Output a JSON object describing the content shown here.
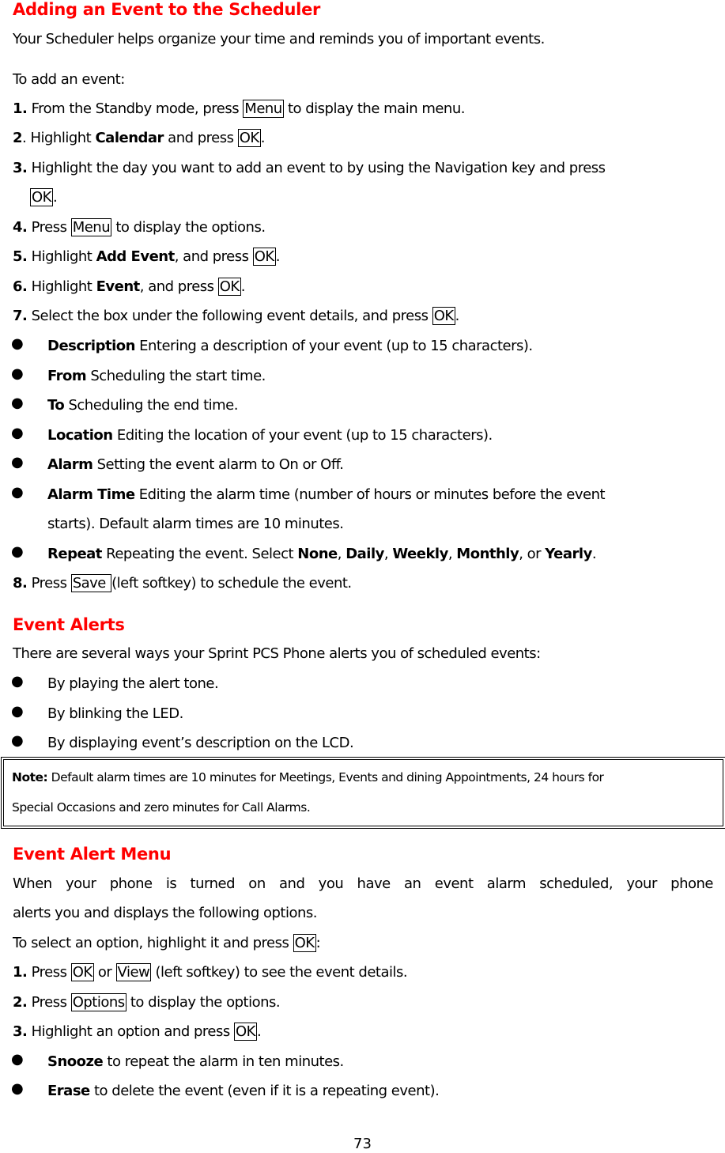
{
  "section1": {
    "title": "Adding an Event to the Scheduler",
    "intro": "Your Scheduler helps organize your time and reminds you of important events.",
    "lead": "To add an event:",
    "steps": [
      {
        "num": "1.",
        "pre": " From the Standby mode, press ",
        "key": "Menu",
        "post": " to display the main menu."
      },
      {
        "num": "2",
        "pre": ". Highlight ",
        "bold": "Calendar",
        "mid": " and press ",
        "key": "OK",
        "post": "."
      },
      {
        "num": "3.",
        "pre": " Highlight the day you want to add an event to by using the Navigation key and press",
        "key": "OK",
        "post": "."
      },
      {
        "num": "4.",
        "pre": " Press ",
        "key": "Menu",
        "post": " to display the options."
      },
      {
        "num": "5.",
        "pre": " Highlight ",
        "bold": "Add Event",
        "mid": ", and press ",
        "key": "OK",
        "post": "."
      },
      {
        "num": "6.",
        "pre": " Highlight ",
        "bold": "Event",
        "mid": ", and press ",
        "key": "OK",
        "post": "."
      },
      {
        "num": "7.",
        "pre": " Select the box under the following event details, and press ",
        "key": "OK",
        "post": "."
      }
    ],
    "details": [
      {
        "term": "Description",
        "text": " Entering a description of your event (up to 15 characters)."
      },
      {
        "term": "From",
        "text": " Scheduling the start time."
      },
      {
        "term": "To",
        "text": " Scheduling the end time."
      },
      {
        "term": "Location",
        "text": " Editing the location of your event (up to 15 characters)."
      },
      {
        "term": "Alarm",
        "text": " Setting the event alarm to On or Off."
      },
      {
        "term": "Alarm Time",
        "text": " Editing the alarm time (number of hours or minutes before the event",
        "text2": "starts). Default alarm times are 10 minutes."
      },
      {
        "term": "Repeat",
        "text": " Repeating the event. Select ",
        "options": [
          "None",
          "Daily",
          "Weekly",
          "Monthly",
          "Yearly"
        ],
        "sep": ", ",
        "or": ", or ",
        "end": "."
      }
    ],
    "step8": {
      "num": "8.",
      "pre": " Press ",
      "key": "Save ",
      "post": "(left softkey) to schedule the event."
    }
  },
  "section2": {
    "title": "Event Alerts",
    "intro": "There are several ways your Sprint PCS Phone alerts you of scheduled events:",
    "bullets": [
      "By playing the alert tone.",
      "By blinking the LED.",
      "By displaying event’s description on the LCD."
    ]
  },
  "note": {
    "label": "Note:",
    "line1": " Default alarm times are 10 minutes for Meetings, Events and dining Appointments, 24 hours for",
    "line2": "Special Occasions and zero minutes for Call Alarms."
  },
  "section3": {
    "title": "Event Alert Menu",
    "intro1": "When your phone is turned on and you have an event alarm scheduled, your phone",
    "intro2": "alerts you and displays the following options.",
    "select": {
      "pre": "To select an option, highlight it and press ",
      "key": "OK",
      "post": ":"
    },
    "steps": [
      {
        "num": "1.",
        "pre": " Press ",
        "key": "OK",
        "mid": " or ",
        "key2": "View",
        "post": " (left softkey) to see the event details."
      },
      {
        "num": "2.",
        "pre": " Press ",
        "key": "Options",
        "post": " to display the options."
      },
      {
        "num": "3.",
        "pre": " Highlight an option and press ",
        "key": "OK",
        "post": "."
      }
    ],
    "options": [
      {
        "term": "Snooze",
        "text": " to repeat the alarm in ten minutes."
      },
      {
        "term": "Erase",
        "text": " to delete the event (even if it is a repeating event)."
      }
    ]
  },
  "footer": {
    "page_number": "73"
  },
  "colors": {
    "heading": "#ff0000",
    "text": "#000000"
  }
}
